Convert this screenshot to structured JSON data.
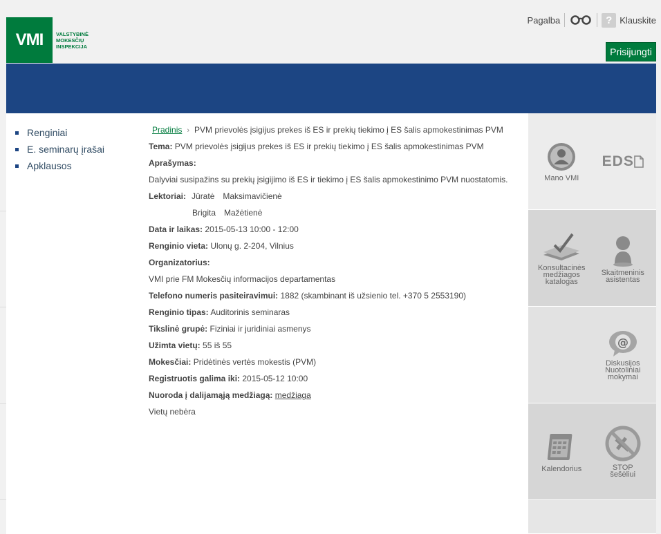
{
  "header": {
    "logo_mark": "VMI",
    "logo_lines": [
      "VALSTYBINĖ",
      "MOKESČIŲ",
      "INSPEKCIJA"
    ],
    "help_link": "Pagalba",
    "ask_link": "Klauskite",
    "ask_icon": "?",
    "login_button": "Prisijungti",
    "brand_color": "#007b3d",
    "banner_color": "#1c4583"
  },
  "sidebar": {
    "items": [
      {
        "label": "Renginiai"
      },
      {
        "label": "E. seminarų įrašai"
      },
      {
        "label": "Apklausos"
      }
    ]
  },
  "breadcrumb": {
    "home": "Pradinis",
    "separator": "›",
    "current": "PVM prievolės įsigijus prekes iš ES ir prekių tiekimo į ES šalis apmokestinimas PVM"
  },
  "event": {
    "topic_label": "Tema:",
    "topic": "PVM prievolės įsigijus prekes iš ES ir prekių tiekimo į ES šalis apmokestinimas PVM",
    "description_label": "Aprašymas:",
    "description": "Dalyviai susipažins su prekių įsigijimo iš ES ir tiekimo į ES šalis apmokestinimo PVM nuostatomis.",
    "lecturers_label": "Lektoriai:",
    "lecturers": [
      {
        "first": "Jūratė",
        "last": "Maksimavičienė"
      },
      {
        "first": "Brigita",
        "last": "Mažėtienė"
      }
    ],
    "datetime_label": "Data ir laikas:",
    "datetime": "2015-05-13 10:00 - 12:00",
    "venue_label": "Renginio vieta:",
    "venue": "Ulonų g. 2-204, Vilnius",
    "organizer_label": "Organizatorius:",
    "organizer": "VMI prie FM Mokesčių informacijos departamentas",
    "phone_label": "Telefono numeris pasiteiravimui:",
    "phone": "1882 (skambinant iš užsienio tel. +370 5 2553190)",
    "type_label": "Renginio tipas:",
    "type": "Auditorinis seminaras",
    "audience_label": "Tikslinė grupė:",
    "audience": "Fiziniai ir juridiniai asmenys",
    "seats_label": "Užimta vietų:",
    "seats": "55 iš 55",
    "taxes_label": "Mokesčiai:",
    "taxes": "Pridėtinės vertės mokestis (PVM)",
    "deadline_label": "Registruotis galima iki:",
    "deadline": "2015-05-12 10:00",
    "materials_label": "Nuoroda į dalijamąją medžiagą:",
    "materials_link": "medžiaga",
    "status": "Vietų nebėra"
  },
  "tiles": {
    "mano_vmi": "Mano VMI",
    "eds": "EDS",
    "consult_catalog": [
      "Konsultacinės",
      "medžiagos",
      "katalogas"
    ],
    "digital_assistant": [
      "Skaitmeninis",
      "asistentas"
    ],
    "discussions": [
      "Diskusijos",
      "Nuotoliniai",
      "mokymai"
    ],
    "calendar": "Kalendorius",
    "stop_shadow": [
      "STOP",
      "šešėliui"
    ]
  }
}
